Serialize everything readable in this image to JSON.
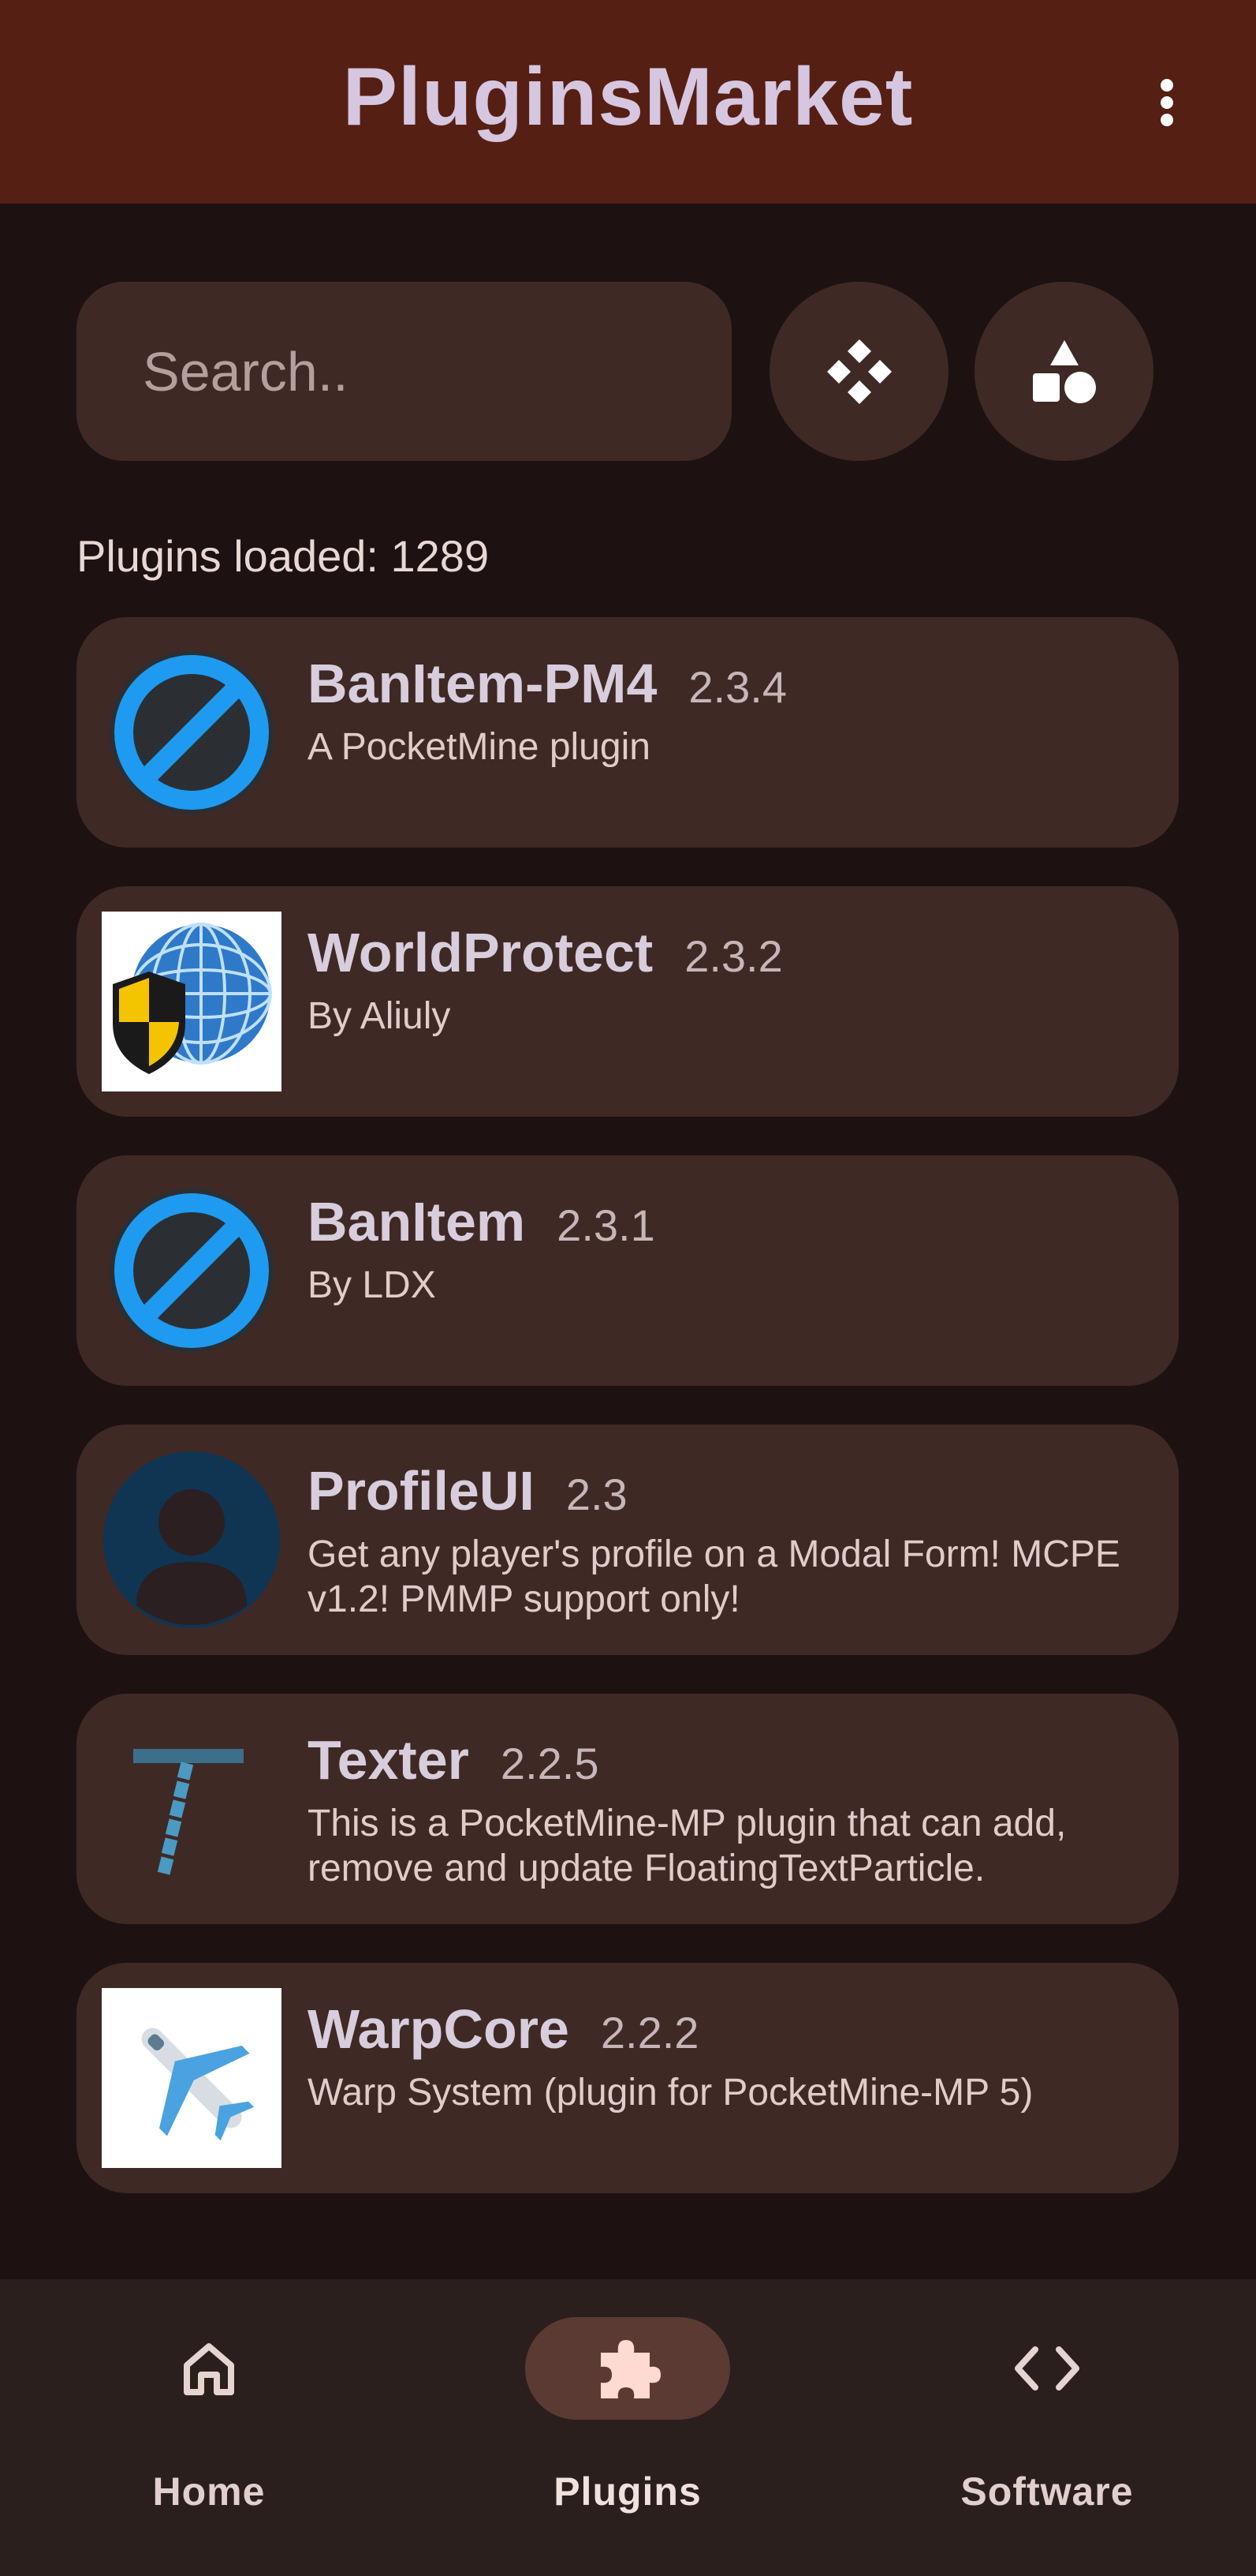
{
  "app_bar": {
    "title": "PluginsMarket",
    "menu_icon": "more-vert-icon"
  },
  "search": {
    "placeholder": "Search..",
    "value": ""
  },
  "toolbar": {
    "filter_icon": "diamond-grid-icon",
    "category_icon": "shapes-icon"
  },
  "status": {
    "count_text": "Plugins loaded: 1289"
  },
  "plugins": [
    {
      "name": "BanItem-PM4",
      "version": "2.3.4",
      "description": "A PocketMine plugin",
      "icon": "ban-icon"
    },
    {
      "name": "WorldProtect",
      "version": "2.3.2",
      "description": "By Aliuly",
      "icon": "globe-shield-icon"
    },
    {
      "name": "BanItem",
      "version": "2.3.1",
      "description": "By LDX",
      "icon": "ban-icon"
    },
    {
      "name": "ProfileUI",
      "version": "2.3",
      "description": "Get any player's profile on a Modal Form! MCPE v1.2! PMMP support only!",
      "icon": "user-avatar-icon"
    },
    {
      "name": "Texter",
      "version": "2.2.5",
      "description": "This is a PocketMine-MP plugin that can add, remove and update FloatingTextParticle.",
      "icon": "texter-icon"
    },
    {
      "name": "WarpCore",
      "version": "2.2.2",
      "description": "Warp System (plugin for PocketMine-MP 5)",
      "icon": "airplane-icon"
    }
  ],
  "nav": {
    "items": [
      {
        "label": "Home",
        "icon": "home-icon"
      },
      {
        "label": "Plugins",
        "icon": "puzzle-icon",
        "active": true
      },
      {
        "label": "Software",
        "icon": "code-icon"
      }
    ]
  },
  "colors": {
    "background": "#1d1211",
    "app_bar": "#561f13",
    "surface": "#3f2925",
    "nav_bar": "#2b1f1d",
    "nav_active_pill": "#5a3a33",
    "ban_blue": "#1e9bf0"
  }
}
